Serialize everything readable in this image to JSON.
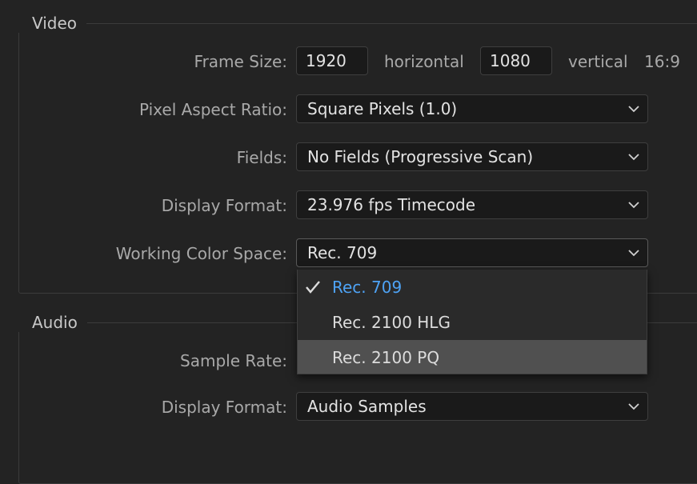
{
  "video": {
    "title": "Video",
    "frame_size": {
      "label": "Frame Size:",
      "width": "1920",
      "horizontal_label": "horizontal",
      "height": "1080",
      "vertical_label": "vertical",
      "aspect": "16:9"
    },
    "pixel_aspect_ratio": {
      "label": "Pixel Aspect Ratio:",
      "value": "Square Pixels (1.0)"
    },
    "fields": {
      "label": "Fields:",
      "value": "No Fields (Progressive Scan)"
    },
    "display_format": {
      "label": "Display Format:",
      "value": "23.976 fps Timecode"
    },
    "working_color_space": {
      "label": "Working Color Space:",
      "value": "Rec. 709",
      "options": [
        {
          "label": "Rec. 709",
          "selected": true
        },
        {
          "label": "Rec. 2100 HLG",
          "selected": false
        },
        {
          "label": "Rec. 2100 PQ",
          "selected": false,
          "hovered": true
        }
      ]
    }
  },
  "audio": {
    "title": "Audio",
    "sample_rate": {
      "label": "Sample Rate:"
    },
    "display_format": {
      "label": "Display Format:",
      "value": "Audio Samples"
    }
  },
  "colors": {
    "selected_option": "#4ea3f5",
    "hover_row": "#505050"
  },
  "icons": {
    "dropdown": "chevron-down-icon",
    "selected": "checkmark-icon"
  }
}
